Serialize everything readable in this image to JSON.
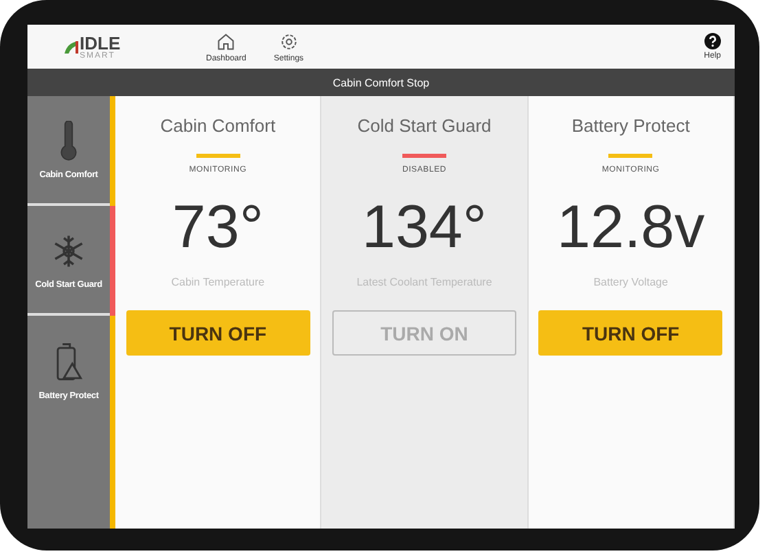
{
  "logo": {
    "text": "IDLE",
    "subtext": "SMART"
  },
  "nav": [
    {
      "label": "Dashboard",
      "kind": "home"
    },
    {
      "label": "Settings",
      "kind": "gear"
    }
  ],
  "help": {
    "label": "Help"
  },
  "title_bar": {
    "title": "Cabin Comfort Stop"
  },
  "sidebar": {
    "items": [
      {
        "label": "Cabin Comfort",
        "kind": "thermometer",
        "color": "#f5b800"
      },
      {
        "label": "Cold Start Guard",
        "kind": "snowflake",
        "color": "#f05a5a"
      },
      {
        "label": "Battery Protect",
        "kind": "battery",
        "color": "#f5b800"
      }
    ]
  },
  "panels": [
    {
      "title": "Cabin Comfort",
      "status": "MONITORING",
      "enabled": true,
      "value": "73°",
      "caption": "Cabin Temperature",
      "button": "TURN OFF"
    },
    {
      "title": "Cold Start Guard",
      "status": "DISABLED",
      "enabled": false,
      "value": "134°",
      "caption": "Latest Coolant Temperature",
      "button": "TURN ON"
    },
    {
      "title": "Battery Protect",
      "status": "MONITORING",
      "enabled": true,
      "value": "12.8v",
      "caption": "Battery Voltage",
      "button": "TURN OFF"
    }
  ]
}
